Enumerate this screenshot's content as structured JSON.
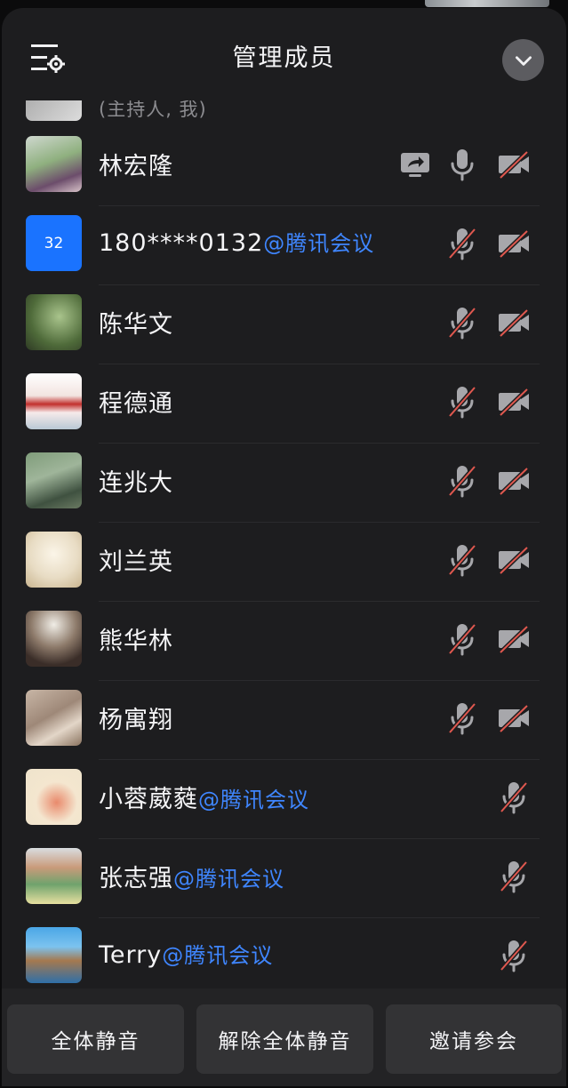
{
  "header": {
    "title": "管理成员",
    "settings_icon": "member-settings-icon",
    "collapse_icon": "chevron-down-icon"
  },
  "partial_member": {
    "label": "(主持人, 我)"
  },
  "members": [
    {
      "name": "林宏隆",
      "tag": "",
      "avatar": "photo",
      "icons": [
        "share-screen-icon",
        "mic-on-icon",
        "camera-off-icon"
      ]
    },
    {
      "name": "180****0132",
      "tag": "@腾讯会议",
      "avatar": "32",
      "avatar_color": "#1a73ff",
      "icons": [
        "mic-off-icon",
        "camera-off-icon"
      ]
    },
    {
      "name": "陈华文",
      "tag": "",
      "avatar": "photo",
      "icons": [
        "mic-off-icon",
        "camera-off-icon"
      ]
    },
    {
      "name": "程德通",
      "tag": "",
      "avatar": "photo",
      "icons": [
        "mic-off-icon",
        "camera-off-icon"
      ]
    },
    {
      "name": "连兆大",
      "tag": "",
      "avatar": "photo",
      "icons": [
        "mic-off-icon",
        "camera-off-icon"
      ]
    },
    {
      "name": "刘兰英",
      "tag": "",
      "avatar": "photo",
      "icons": [
        "mic-off-icon",
        "camera-off-icon"
      ]
    },
    {
      "name": "熊华林",
      "tag": "",
      "avatar": "photo",
      "icons": [
        "mic-off-icon",
        "camera-off-icon"
      ]
    },
    {
      "name": "杨寓翔",
      "tag": "",
      "avatar": "photo",
      "icons": [
        "mic-off-icon",
        "camera-off-icon"
      ]
    },
    {
      "name": "小蓉葳蕤",
      "tag": "@腾讯会议",
      "avatar": "photo",
      "icons": [
        "mic-off-icon"
      ]
    },
    {
      "name": "张志强",
      "tag": "@腾讯会议",
      "avatar": "photo",
      "icons": [
        "mic-off-icon"
      ]
    },
    {
      "name": "Terry",
      "tag": "@腾讯会议",
      "avatar": "photo",
      "icons": [
        "mic-off-icon"
      ]
    }
  ],
  "footer": {
    "mute_all": "全体静音",
    "unmute_all": "解除全体静音",
    "invite": "邀请参会"
  },
  "colors": {
    "panel_bg": "#1d1d1f",
    "accent_blue": "#3f86ff",
    "muted_red": "#e0584f",
    "icon_gray": "#a7a7ab"
  }
}
